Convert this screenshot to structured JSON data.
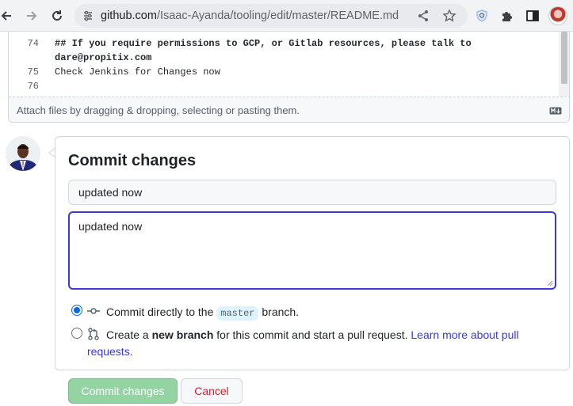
{
  "browser": {
    "url_host": "github.com",
    "url_path": "/Isaac-Ayanda/tooling/edit/master/README.md"
  },
  "editor": {
    "lines": [
      {
        "num": "74",
        "text": "## If you require permissions to GCP, or Gitlab resources, please talk to",
        "bold": true
      },
      {
        "num": "",
        "text": "dare@propitix.com",
        "bold": true
      },
      {
        "num": "75",
        "text": "Check Jenkins for Changes now",
        "bold": false
      },
      {
        "num": "76",
        "text": "",
        "bold": false
      }
    ],
    "attach_hint": "Attach files by dragging & dropping, selecting or pasting them."
  },
  "commit": {
    "title": "Commit changes",
    "summary_value": "updated now",
    "description_value": "updated now",
    "option_direct": {
      "prefix": "Commit directly to the",
      "branch": "master",
      "suffix": "branch."
    },
    "option_new_branch": {
      "prefix": "Create a",
      "bold": "new branch",
      "middle": "for this commit and start a pull request.",
      "link_part1": "Learn more about pull",
      "link_part2": "requests."
    },
    "commit_button": "Commit changes",
    "cancel_button": "Cancel"
  },
  "colors": {
    "accent_focus": "#3a3ad6",
    "commit_button_bg": "#94d3a2",
    "cancel_text": "#cf222e",
    "branch_chip_bg": "#ddf4ff"
  }
}
